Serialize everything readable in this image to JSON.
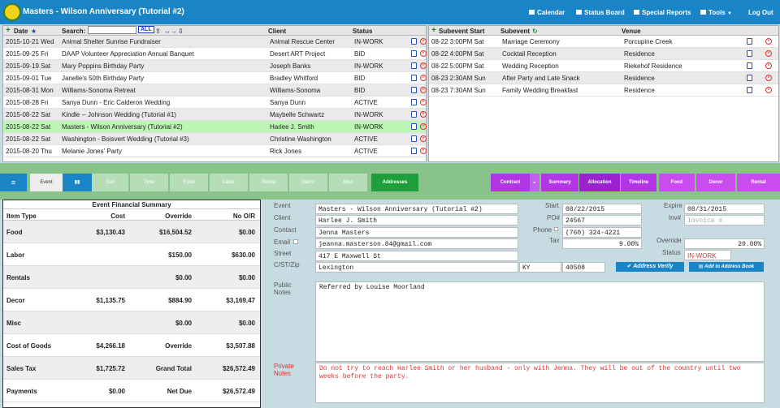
{
  "app": {
    "title": "Masters - Wilson Anniversary (Tutorial #2)"
  },
  "nav": {
    "calendar": "Calendar",
    "status_board": "Status Board",
    "special_reports": "Special Reports",
    "tools": "Tools",
    "logout": "Log Out"
  },
  "events": {
    "headers": {
      "date": "Date",
      "search": "Search:",
      "all": "ALL",
      "client": "Client",
      "status": "Status"
    },
    "search_value": "",
    "rows": [
      {
        "date": "2015-10-21 Wed",
        "name": "Animal Shelter Sunrise Fundraiser",
        "client": "Animal Rescue Center",
        "status": "IN-WORK"
      },
      {
        "date": "2015-09-25 Fri",
        "name": "DAAP Volunteer Appreciation Annual Banquet",
        "client": "Desert ART Project",
        "status": "BID"
      },
      {
        "date": "2015-09-19 Sat",
        "name": "Mary Poppins Birthday Party",
        "client": "Joseph Banks",
        "status": "IN-WORK"
      },
      {
        "date": "2015-09-01 Tue",
        "name": "Janelle's 50th Birthday Party",
        "client": "Bradley Whitford",
        "status": "BID"
      },
      {
        "date": "2015-08-31 Mon",
        "name": "Williams-Sonoma Retreat",
        "client": "Williams-Sonoma",
        "status": "BID"
      },
      {
        "date": "2015-08-28 Fri",
        "name": "Sanya Dunn - Eric Calderon Wedding",
        "client": "Sanya Dunn",
        "status": "ACTIVE"
      },
      {
        "date": "2015-08-22 Sat",
        "name": "Kindle -- Johnson Wedding (Tutorial #1)",
        "client": "Maybelle Schwartz",
        "status": "IN-WORK"
      },
      {
        "date": "2015-08-22 Sat",
        "name": "Masters - Wilson Anniversary (Tutorial #2)",
        "client": "Harlee J. Smith",
        "status": "IN-WORK"
      },
      {
        "date": "2015-08-22 Sat",
        "name": "Washington - Boisvert Wedding (Tutorial #3)",
        "client": "Christine Washington",
        "status": "ACTIVE"
      },
      {
        "date": "2015-08-20 Thu",
        "name": "Melanie Jones' Party",
        "client": "Rick Jones",
        "status": "ACTIVE"
      }
    ]
  },
  "subevents": {
    "headers": {
      "start": "Subevent Start",
      "subevent": "Subevent",
      "venue": "Venue"
    },
    "rows": [
      {
        "start": "08-22 3:00PM Sat",
        "name": "Marriage Ceremony",
        "venue": "Porcupine Creek"
      },
      {
        "start": "08-22 4:00PM Sat",
        "name": "Cocktail Reception",
        "venue": "Residence"
      },
      {
        "start": "08-22 5:00PM Sat",
        "name": "Wedding Reception",
        "venue": "Riekehof Residence"
      },
      {
        "start": "08-23 2:30AM Sun",
        "name": "After Party and Late Snack",
        "venue": "Residence"
      },
      {
        "start": "08-23 7:30AM Sun",
        "name": "Family Wedding Breakfast",
        "venue": "Residence"
      }
    ]
  },
  "tabs": {
    "left": [
      "Event",
      "Sub",
      "Time",
      "Food",
      "Labor",
      "Rental",
      "Decor",
      "Misc"
    ],
    "addresses": "Addresses",
    "right": [
      "Contract",
      "Summary",
      "Allocation",
      "Timeline",
      "Food",
      "Decor",
      "Rental"
    ]
  },
  "financial": {
    "title": "Event Financial Summary",
    "headers": {
      "item": "Item Type",
      "cost": "Cost",
      "override": "Override",
      "noor": "No O/R"
    },
    "rows": [
      {
        "item": "Food",
        "cost": "$3,130.43",
        "override": "$16,504.52",
        "noor": "$0.00"
      },
      {
        "item": "Labor",
        "cost": "",
        "override": "$150.00",
        "noor": "$630.00"
      },
      {
        "item": "Rentals",
        "cost": "",
        "override": "$0.00",
        "noor": "$0.00"
      },
      {
        "item": "Decor",
        "cost": "$1,135.75",
        "override": "$884.90",
        "noor": "$3,169.47"
      },
      {
        "item": "Misc",
        "cost": "",
        "override": "$0.00",
        "noor": "$0.00"
      },
      {
        "item": "Cost of Goods",
        "cost": "$4,266.18",
        "override": "Override",
        "noor": "$3,507.88"
      },
      {
        "item": "Sales Tax",
        "cost": "$1,725.72",
        "override": "Grand Total",
        "noor": "$26,572.49"
      },
      {
        "item": "Payments",
        "cost": "$0.00",
        "override": "Net Due",
        "noor": "$26,572.49"
      }
    ]
  },
  "form": {
    "labels": {
      "event": "Event",
      "client": "Client",
      "contact": "Contact",
      "email": "Email",
      "street": "Street",
      "cstzip": "C/ST/Zip",
      "start": "Start",
      "po": "PO#",
      "phone": "Phone",
      "tax": "Tax",
      "expire": "Expire",
      "inv": "Inv#",
      "override": "Override",
      "status": "Status",
      "public_notes_1": "Public",
      "public_notes_2": "Notes",
      "private_notes_1": "Private",
      "private_notes_2": "Notes"
    },
    "event": "Masters - Wilson Anniversary (Tutorial #2)",
    "client": "Harlee J. Smith",
    "contact": "Jenna Masters",
    "email": "jeanna.masterson.84@gmail.com",
    "street": "417 E Maxwell St",
    "city": "Lexington",
    "state": "KY",
    "zip": "40508",
    "start": "08/22/2015",
    "po": "24567",
    "phone": "(760) 324-4221",
    "tax": "9.00%",
    "expire": "08/31/2015",
    "inv_placeholder": "Invoice #",
    "override": "20.00%",
    "status": "IN-WORK",
    "address_verify": "Address Verify",
    "add_to_book": "Add to Address Book",
    "public_notes": "Referred by Louise Moorland",
    "private_notes": "Do not try to reach Harlee Smith or her husband - only with Jenna. They will be out of the country until two weeks before the party."
  }
}
